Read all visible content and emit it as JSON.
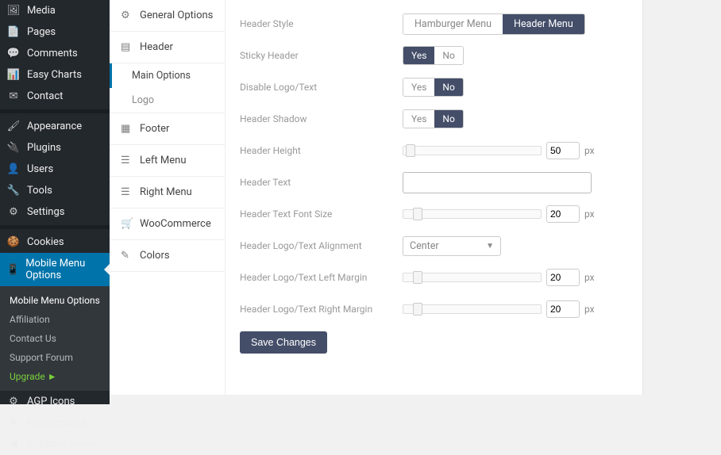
{
  "sidebar": {
    "items": [
      {
        "label": "Media",
        "icon": "🖼"
      },
      {
        "label": "Pages",
        "icon": "📄"
      },
      {
        "label": "Comments",
        "icon": "💬"
      },
      {
        "label": "Easy Charts",
        "icon": "📊"
      },
      {
        "label": "Contact",
        "icon": "✉"
      }
    ],
    "items2": [
      {
        "label": "Appearance",
        "icon": "🖌"
      },
      {
        "label": "Plugins",
        "icon": "🔌"
      },
      {
        "label": "Users",
        "icon": "👤"
      },
      {
        "label": "Tools",
        "icon": "🔧"
      },
      {
        "label": "Settings",
        "icon": "⚙"
      }
    ],
    "items3": [
      {
        "label": "Cookies",
        "icon": "🍪"
      },
      {
        "label": "Mobile Menu Options",
        "icon": "📱"
      }
    ],
    "submenu": {
      "head": "Mobile Menu Options",
      "items": [
        "Affiliation",
        "Contact Us",
        "Support Forum"
      ],
      "upgrade": "Upgrade ►"
    },
    "items4": [
      {
        "label": "AGP Icons",
        "icon": "⚙"
      },
      {
        "label": "Maintenance",
        "icon": "✱"
      },
      {
        "label": "Collapse menu",
        "icon": "◀"
      }
    ]
  },
  "tabs": [
    {
      "label": "General Options",
      "icon": "⚙"
    },
    {
      "label": "Header",
      "icon": "▤",
      "sub": [
        "Main Options",
        "Logo"
      ],
      "activeSub": 0
    },
    {
      "label": "Footer",
      "icon": "▦"
    },
    {
      "label": "Left Menu",
      "icon": "☰"
    },
    {
      "label": "Right Menu",
      "icon": "☰"
    },
    {
      "label": "WooCommerce",
      "icon": "🛒"
    },
    {
      "label": "Colors",
      "icon": "✎"
    }
  ],
  "form": {
    "header_style": {
      "label": "Header Style",
      "options": [
        "Hamburger Menu",
        "Header Menu"
      ],
      "selected": 1
    },
    "sticky": {
      "label": "Sticky Header",
      "options": [
        "Yes",
        "No"
      ],
      "selected": 0
    },
    "disable_logo": {
      "label": "Disable Logo/Text",
      "options": [
        "Yes",
        "No"
      ],
      "selected": 1
    },
    "shadow": {
      "label": "Header Shadow",
      "options": [
        "Yes",
        "No"
      ],
      "selected": 1
    },
    "height": {
      "label": "Header Height",
      "value": "50",
      "unit": "px",
      "thumb": 3
    },
    "text": {
      "label": "Header Text",
      "value": ""
    },
    "font_size": {
      "label": "Header Text Font Size",
      "value": "20",
      "unit": "px",
      "thumb": 12
    },
    "alignment": {
      "label": "Header Logo/Text Alignment",
      "value": "Center"
    },
    "lmargin": {
      "label": "Header Logo/Text Left Margin",
      "value": "20",
      "unit": "px",
      "thumb": 12
    },
    "rmargin": {
      "label": "Header Logo/Text Right Margin",
      "value": "20",
      "unit": "px",
      "thumb": 12
    },
    "save": "Save Changes"
  }
}
